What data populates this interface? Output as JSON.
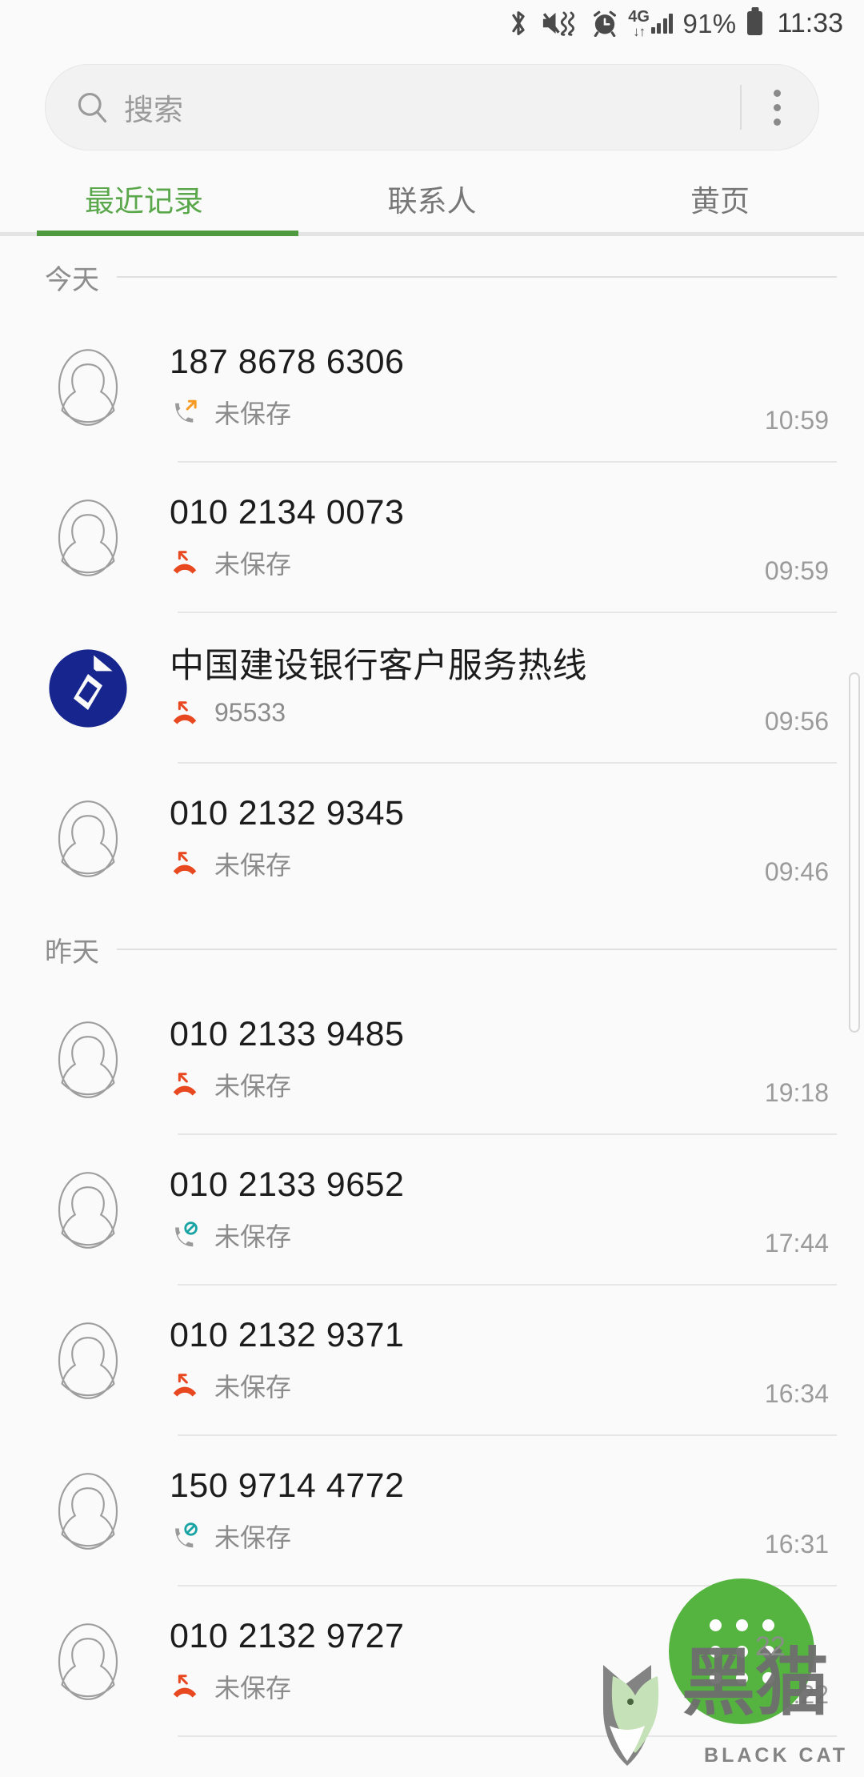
{
  "status_bar": {
    "icons": [
      "bluetooth-icon",
      "mute-vibrate-icon",
      "alarm-icon",
      "network-4g-icon",
      "signal-bars-icon",
      "battery-icon"
    ],
    "network_label": "4G",
    "network_arrows": "↓↑",
    "battery_percent": "91%",
    "clock": "11:33"
  },
  "search": {
    "placeholder": "搜索",
    "icon": "search-icon",
    "menu_icon": "more-vertical-icon"
  },
  "tabs": [
    {
      "label": "最近记录",
      "active": true
    },
    {
      "label": "联系人",
      "active": false
    },
    {
      "label": "黄页",
      "active": false
    }
  ],
  "colors": {
    "accent_green": "#4f9a3f",
    "fab_green": "#55b340",
    "missed_red": "#e8481f",
    "outgoing_orange": "#f59a23",
    "blocked_teal": "#1aa3a3",
    "ccb_blue": "#17268f",
    "background": "#fafafa",
    "divider": "#e6e6e6"
  },
  "call_log": [
    {
      "section": "今天",
      "entries": [
        {
          "avatar": "default-avatar",
          "title": "187 8678 6306",
          "call_type": "outgoing",
          "subtitle": "未保存",
          "time": "10:59"
        },
        {
          "avatar": "default-avatar",
          "title": "010 2134 0073",
          "call_type": "missed",
          "subtitle": "未保存",
          "time": "09:59"
        },
        {
          "avatar": "ccb-logo",
          "title": "中国建设银行客户服务热线",
          "call_type": "missed",
          "subtitle": "95533",
          "time": "09:56"
        },
        {
          "avatar": "default-avatar",
          "title": "010 2132 9345",
          "call_type": "missed",
          "subtitle": "未保存",
          "time": "09:46"
        }
      ]
    },
    {
      "section": "昨天",
      "entries": [
        {
          "avatar": "default-avatar",
          "title": "010 2133 9485",
          "call_type": "missed",
          "subtitle": "未保存",
          "time": "19:18"
        },
        {
          "avatar": "default-avatar",
          "title": "010 2133 9652",
          "call_type": "blocked",
          "subtitle": "未保存",
          "time": "17:44"
        },
        {
          "avatar": "default-avatar",
          "title": "010 2132 9371",
          "call_type": "missed",
          "subtitle": "未保存",
          "time": "16:34"
        },
        {
          "avatar": "default-avatar",
          "title": "150 9714 4772",
          "call_type": "blocked",
          "subtitle": "未保存",
          "time": "16:31"
        },
        {
          "avatar": "default-avatar",
          "title": "010 2132 9727",
          "call_type": "missed",
          "subtitle": "未保存",
          "time": "16:22"
        }
      ]
    }
  ],
  "fab": {
    "icon": "dialpad-icon"
  },
  "watermark": {
    "text": "BLACK CAT",
    "brand": "黑猫"
  }
}
